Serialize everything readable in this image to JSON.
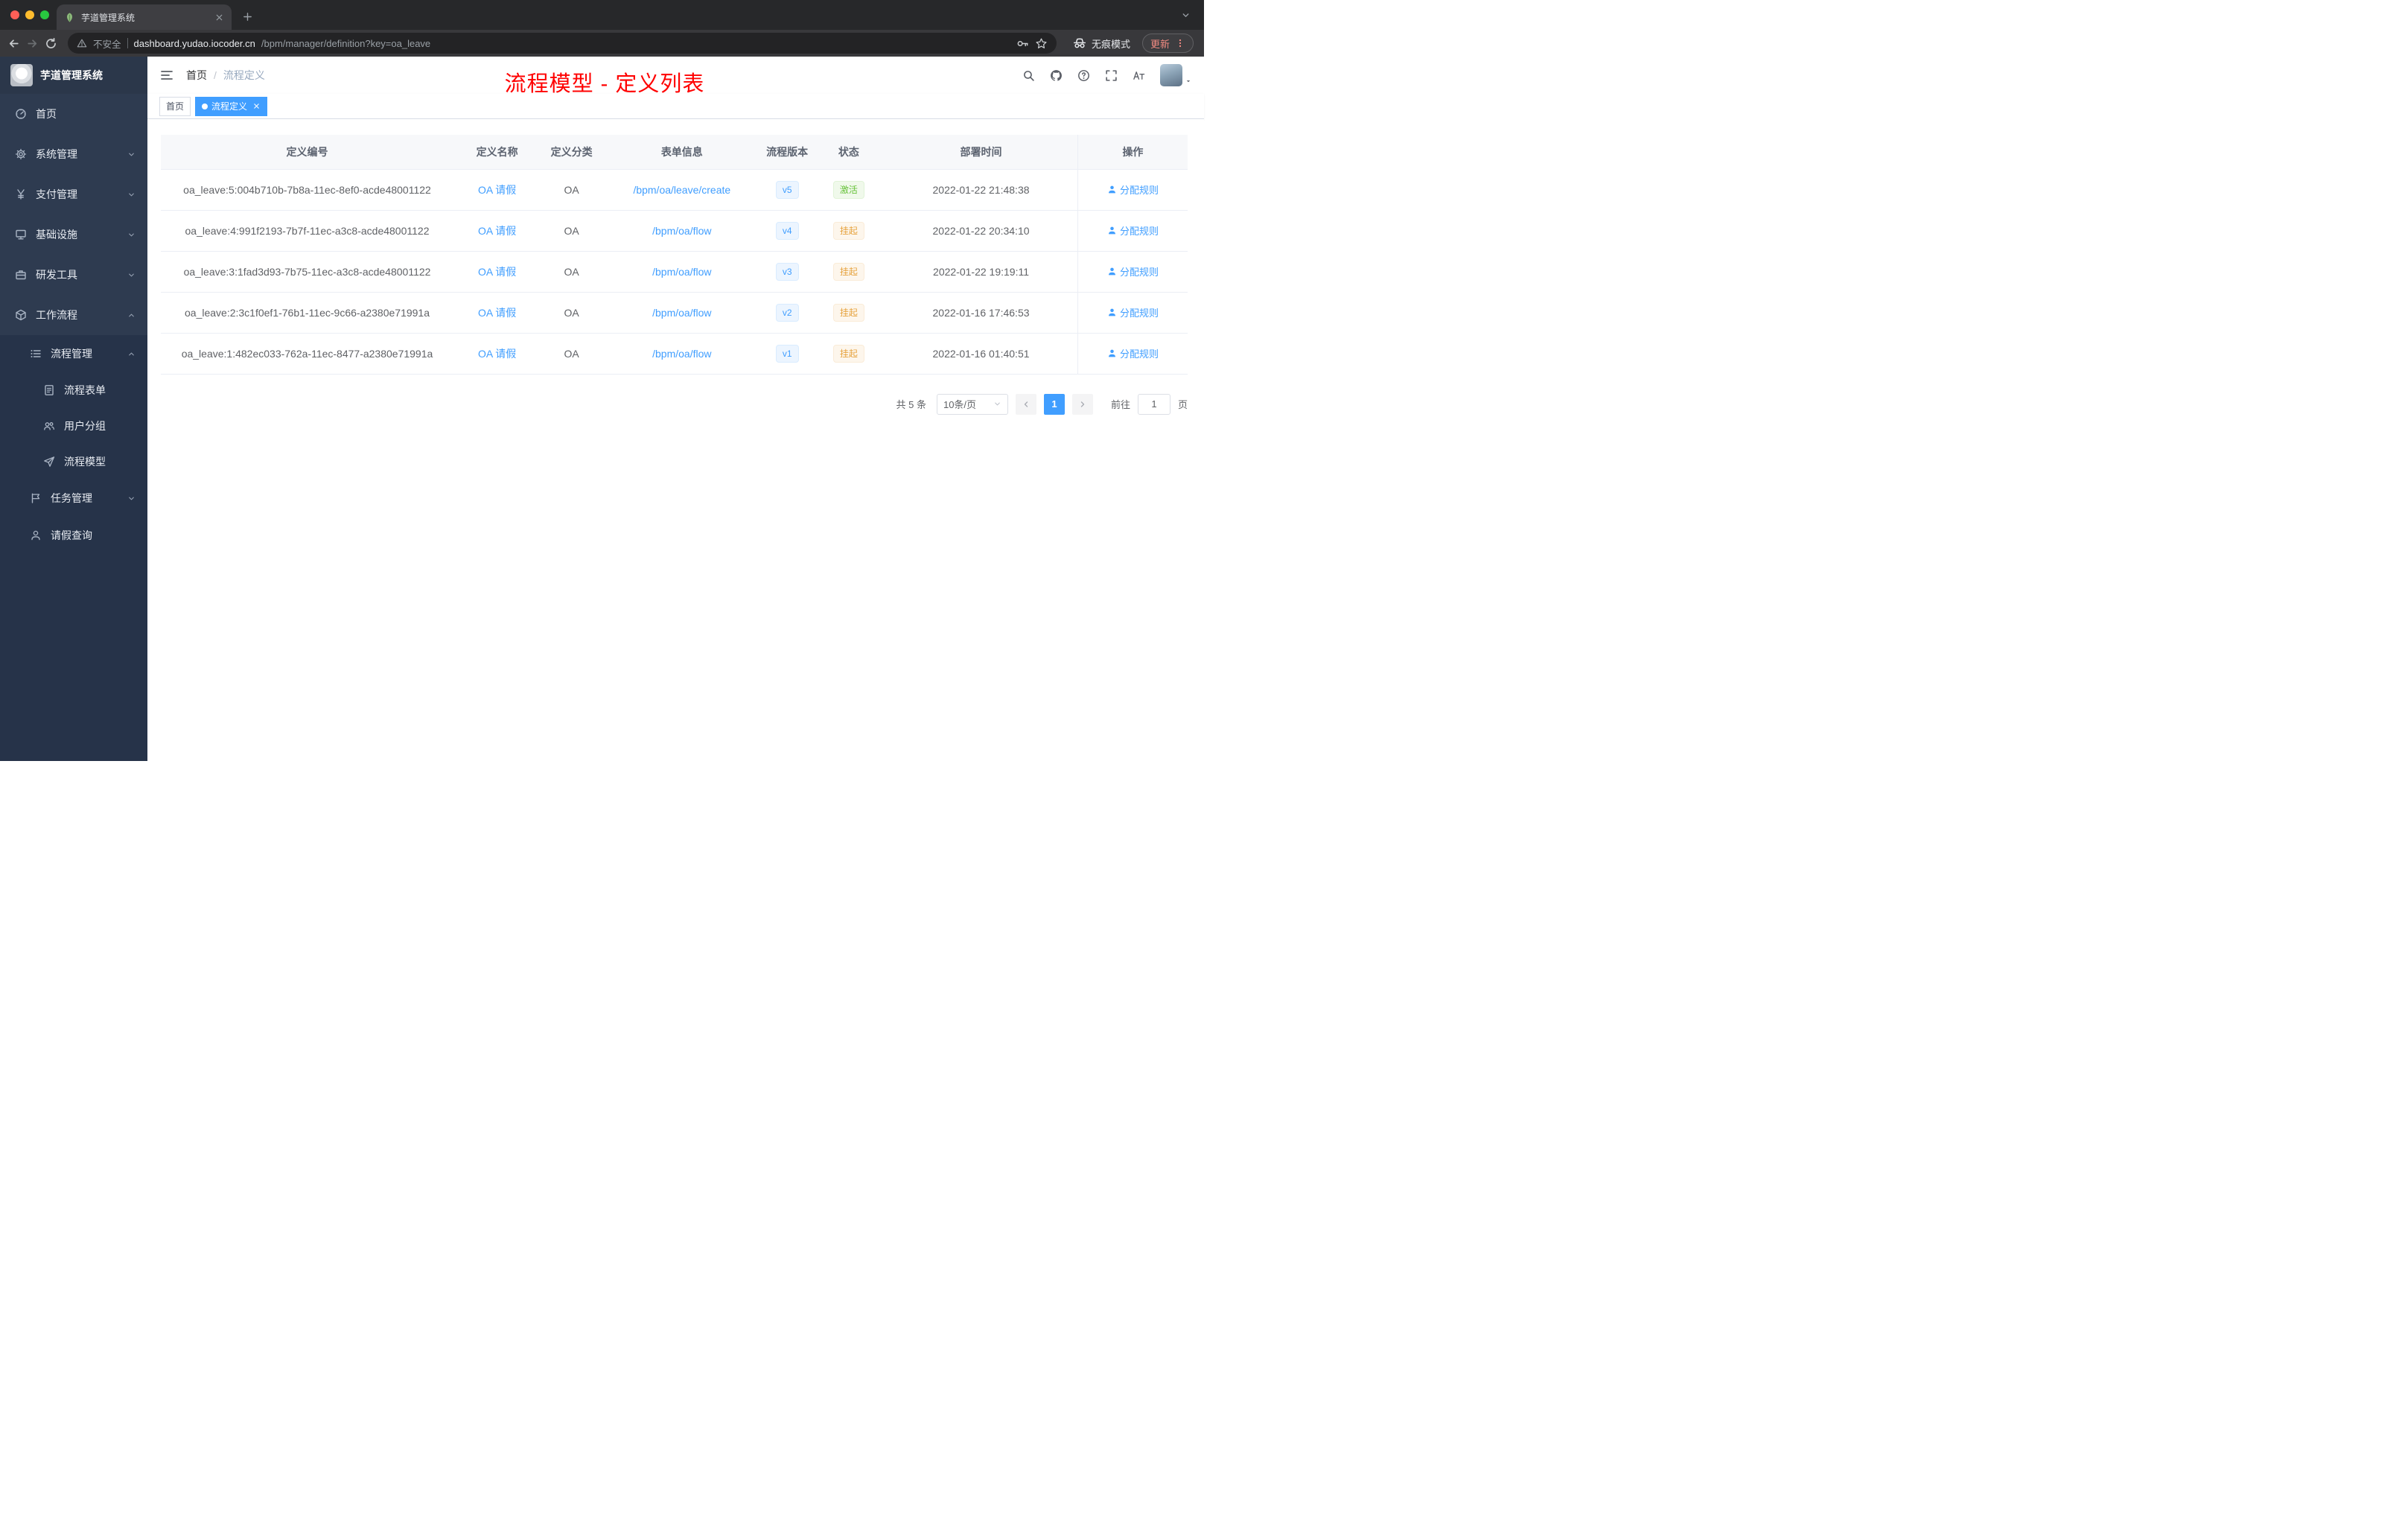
{
  "browser": {
    "tab_title": "芋道管理系统",
    "security_label": "不安全",
    "url_host": "dashboard.yudao.iocoder.cn",
    "url_path": "/bpm/manager/definition?key=oa_leave",
    "incognito_label": "无痕模式",
    "update_label": "更新"
  },
  "sidebar": {
    "logo_title": "芋道管理系统",
    "menu": [
      {
        "key": "home",
        "label": "首页",
        "icon": "dashboard",
        "level": 1
      },
      {
        "key": "system",
        "label": "系统管理",
        "icon": "gear",
        "level": 1,
        "chevron": "down"
      },
      {
        "key": "payment",
        "label": "支付管理",
        "icon": "yen",
        "level": 1,
        "chevron": "down"
      },
      {
        "key": "infrastructure",
        "label": "基础设施",
        "icon": "infra",
        "level": 1,
        "chevron": "down"
      },
      {
        "key": "devtools",
        "label": "研发工具",
        "icon": "toolbox",
        "level": 1,
        "chevron": "down"
      },
      {
        "key": "workflow",
        "label": "工作流程",
        "icon": "workflow",
        "level": 1,
        "chevron": "up"
      },
      {
        "key": "process-mgmt",
        "label": "流程管理",
        "icon": "listmgmt",
        "level": 2,
        "chevron": "up"
      },
      {
        "key": "process-form",
        "label": "流程表单",
        "icon": "form",
        "level": 3
      },
      {
        "key": "user-group",
        "label": "用户分组",
        "icon": "usergroup",
        "level": 3
      },
      {
        "key": "process-model",
        "label": "流程模型",
        "icon": "send",
        "level": 3
      },
      {
        "key": "task-mgmt",
        "label": "任务管理",
        "icon": "task",
        "level": 2,
        "chevron": "down"
      },
      {
        "key": "leave-query",
        "label": "请假查询",
        "icon": "person",
        "level": 2
      }
    ]
  },
  "header": {
    "breadcrumb_home": "首页",
    "breadcrumb_separator": "/",
    "breadcrumb_current": "流程定义",
    "overlay_title": "流程模型 - 定义列表"
  },
  "tags": [
    {
      "label": "首页",
      "active": false,
      "closable": false
    },
    {
      "label": "流程定义",
      "active": true,
      "closable": true
    }
  ],
  "table": {
    "columns": [
      "定义编号",
      "定义名称",
      "定义分类",
      "表单信息",
      "流程版本",
      "状态",
      "部署时间",
      "操作"
    ],
    "rows": [
      {
        "id": "oa_leave:5:004b710b-7b8a-11ec-8ef0-acde48001122",
        "name": "OA 请假",
        "category": "OA",
        "form": "/bpm/oa/leave/create",
        "version": "v5",
        "status": "激活",
        "status_type": "success",
        "deploy_time": "2022-01-22 21:48:38",
        "action": "分配规则"
      },
      {
        "id": "oa_leave:4:991f2193-7b7f-11ec-a3c8-acde48001122",
        "name": "OA 请假",
        "category": "OA",
        "form": "/bpm/oa/flow",
        "version": "v4",
        "status": "挂起",
        "status_type": "warning",
        "deploy_time": "2022-01-22 20:34:10",
        "action": "分配规则"
      },
      {
        "id": "oa_leave:3:1fad3d93-7b75-11ec-a3c8-acde48001122",
        "name": "OA 请假",
        "category": "OA",
        "form": "/bpm/oa/flow",
        "version": "v3",
        "status": "挂起",
        "status_type": "warning",
        "deploy_time": "2022-01-22 19:19:11",
        "action": "分配规则"
      },
      {
        "id": "oa_leave:2:3c1f0ef1-76b1-11ec-9c66-a2380e71991a",
        "name": "OA 请假",
        "category": "OA",
        "form": "/bpm/oa/flow",
        "version": "v2",
        "status": "挂起",
        "status_type": "warning",
        "deploy_time": "2022-01-16 17:46:53",
        "action": "分配规则"
      },
      {
        "id": "oa_leave:1:482ec033-762a-11ec-8477-a2380e71991a",
        "name": "OA 请假",
        "category": "OA",
        "form": "/bpm/oa/flow",
        "version": "v1",
        "status": "挂起",
        "status_type": "warning",
        "deploy_time": "2022-01-16 01:40:51",
        "action": "分配规则"
      }
    ]
  },
  "pagination": {
    "total_label": "共 5 条",
    "page_size": "10条/页",
    "current_page": "1",
    "goto_label": "前往",
    "goto_value": "1",
    "page_unit": "页"
  },
  "colors": {
    "accent": "#409eff",
    "success": "#67c23a",
    "warning": "#e6a23c",
    "annotation_red": "#ff0000",
    "sidebar_bg": "#2e3b50",
    "sidebar_sub_bg": "#263349"
  }
}
